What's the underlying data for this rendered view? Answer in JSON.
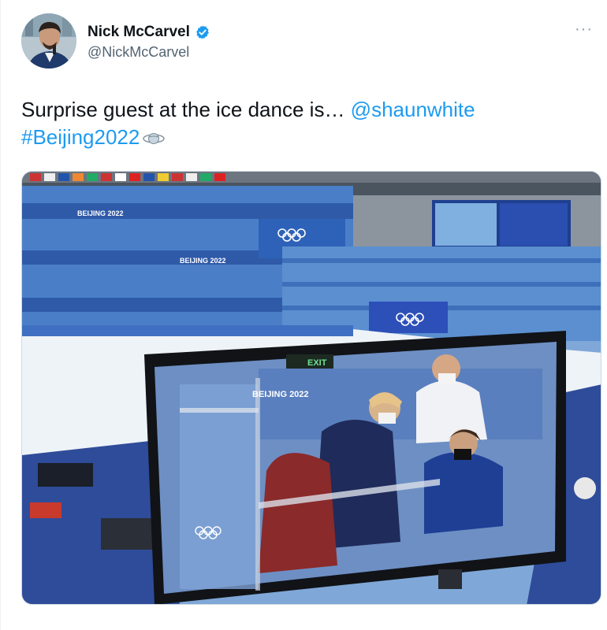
{
  "author": {
    "display_name": "Nick McCarvel",
    "handle": "@NickMcCarvel",
    "avatar_icon": "avatar-photo",
    "verified_icon": "verified-badge-icon"
  },
  "menu": {
    "more_label": "···"
  },
  "tweet": {
    "text_before": "Surprise guest at the ice dance is… ",
    "mention": "@shaunwhite",
    "hashtag": "#Beijing2022",
    "hashtag_emoji": "olympic-globe-icon"
  },
  "media": {
    "banner_text_1": "BEIJING 2022",
    "banner_text_2": "BEIJING 2022",
    "banner_text_3": "BEIJING 2022",
    "exit_sign": "EXIT",
    "colors": {
      "link": "#1d9bf0",
      "verified": "#1d9bf0",
      "arena_blue": "#3b73c6"
    }
  }
}
